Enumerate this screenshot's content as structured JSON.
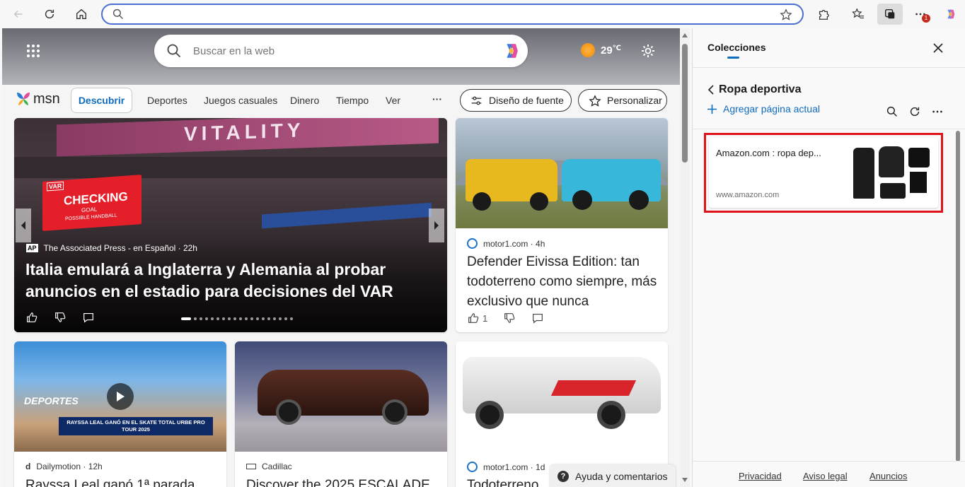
{
  "browser": {
    "address_placeholder": "",
    "notification_badge": "1"
  },
  "msn": {
    "search_placeholder": "Buscar en la web",
    "weather_temp": "29",
    "weather_unit": "℃",
    "logo_text": "msn",
    "nav": {
      "discover": "Descubrir",
      "items": [
        "Deportes",
        "Juegos casuales",
        "Dinero",
        "Tiempo",
        "Ver"
      ],
      "more": "···",
      "font_design": "Diseño de fuente",
      "personalize": "Personalizar"
    },
    "hero": {
      "banner_text": "VITALITY",
      "board_text": "VAR",
      "checking_title": "CHECKING",
      "checking_line2": "GOAL",
      "checking_line3": "POSSIBLE HANDBALL",
      "source_logo": "AP",
      "source": "The Associated Press - en Español · 22h",
      "title": "Italia emulará a Inglaterra y Alemania al probar anuncios en el estadio para decisiones del VAR"
    },
    "card_defender": {
      "source": "motor1.com · 4h",
      "title": "Defender Eivissa Edition: tan todoterreno como siempre, más exclusivo que nunca",
      "likes": "1"
    },
    "card_rayssa": {
      "thumb_label": "DEPORTES",
      "thumb_caption": "RAYSSA LEAL GANÓ EN EL SKATE TOTAL URBE PRO TOUR 2025",
      "source": "Dailymotion · 12h",
      "title": "Rayssa Leal ganó 1ª parada"
    },
    "card_cadillac": {
      "source": "Cadillac",
      "title": "Discover the 2025 ESCALADE"
    },
    "card_motor2": {
      "source": "motor1.com · 1d",
      "title": "Todoterreno"
    },
    "help": "Ayuda y comentarios"
  },
  "collections": {
    "header": "Colecciones",
    "collection_name": "Ropa deportiva",
    "add_page": "Agregar página actual",
    "item": {
      "title": "Amazon.com : ropa dep...",
      "url": "www.amazon.com"
    },
    "footer": [
      "Privacidad",
      "Aviso legal",
      "Anuncios"
    ]
  },
  "colors": {
    "accent_blue": "#0f6cbd",
    "highlight_red": "#e0131b"
  }
}
